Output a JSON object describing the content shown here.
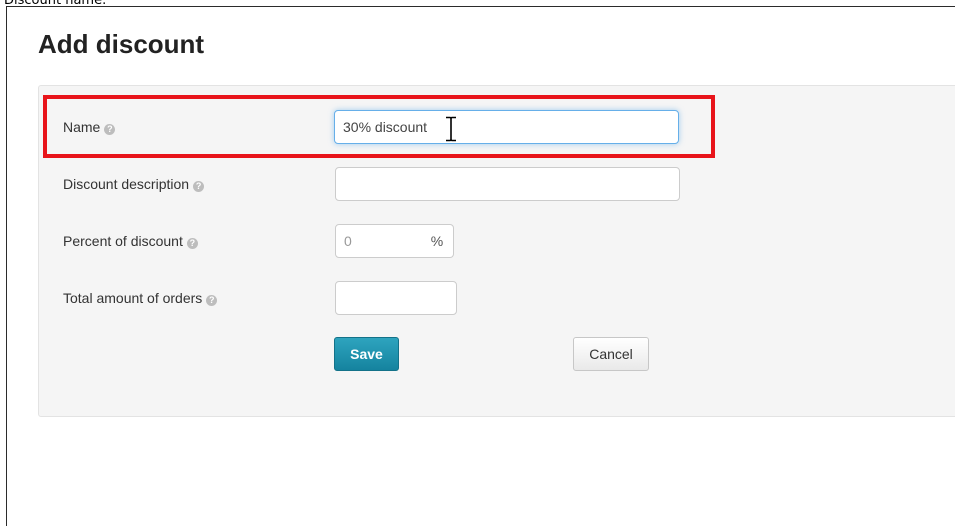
{
  "caption": "Discount name.",
  "page_title": "Add discount",
  "form": {
    "name": {
      "label": "Name",
      "value": "30% discount"
    },
    "description": {
      "label": "Discount description",
      "value": ""
    },
    "percent": {
      "label": "Percent of discount",
      "placeholder": "0",
      "unit": "%"
    },
    "total_orders": {
      "label": "Total amount of orders",
      "value": ""
    },
    "help_icon_glyph": "?"
  },
  "buttons": {
    "save": "Save",
    "cancel": "Cancel"
  },
  "colors": {
    "highlight": "#e8141a",
    "save_button": "#1a8aa6",
    "panel_background": "#f5f5f5"
  },
  "icons": {
    "help": "question-circle-icon",
    "cursor": "text-cursor-icon"
  }
}
